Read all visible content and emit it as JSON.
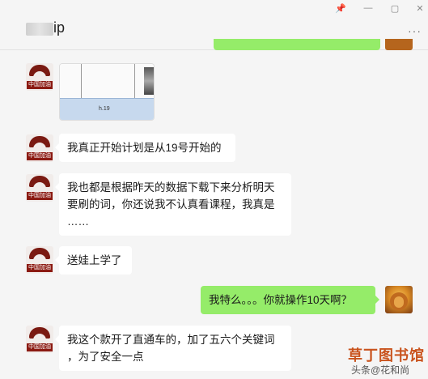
{
  "header": {
    "title_suffix": "ip",
    "window_controls": [
      "📌",
      "—",
      "▢",
      "✕"
    ],
    "more_label": "···"
  },
  "avatar_tag": "中国加油",
  "image_message": {
    "cell_text": "h.19"
  },
  "messages": [
    {
      "side": "left",
      "lines": [
        "我真正开始计划是从19号开始的"
      ]
    },
    {
      "side": "left",
      "lines": [
        "我也都是根据昨天的数据下载下来分析明天",
        "要刷的词，你还说我不认真看课程，我真是",
        "……"
      ]
    },
    {
      "side": "left",
      "lines": [
        "送娃上学了"
      ]
    },
    {
      "side": "right",
      "lines": [
        "我特么。。。你就操作10天啊？"
      ]
    },
    {
      "side": "left",
      "lines": [
        "我这个款开了直通车的，加了五六个关键词",
        "，为了安全一点"
      ]
    }
  ],
  "watermark": {
    "brand": "草丁图书馆",
    "sub": "头条@花和尚"
  },
  "colors": {
    "background": "#f5f5f5",
    "bubble_left": "#ffffff",
    "bubble_right": "#95ec69",
    "watermark": "#c9531d"
  }
}
